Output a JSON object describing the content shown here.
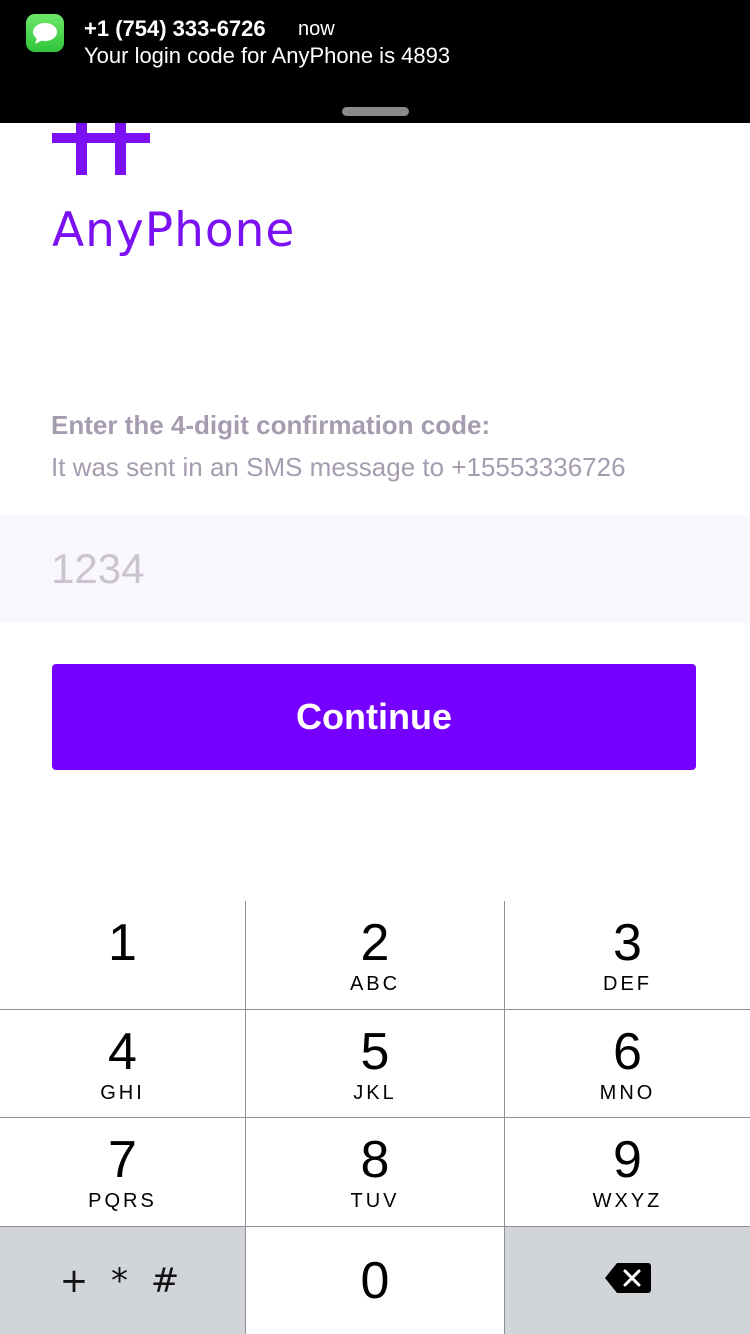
{
  "notification": {
    "app_icon": "messages-icon",
    "sender": "+1 (754) 333-6726",
    "time": "now",
    "message": "Your login code for AnyPhone is 4893"
  },
  "brand": {
    "name": "AnyPhone",
    "logo_icon": "hash-logo-icon",
    "color": "#7b10f2"
  },
  "prompt": {
    "heading": "Enter the 4-digit confirmation code:",
    "subtext": "It was sent in an SMS message to +15553336726"
  },
  "code_input": {
    "value": "",
    "placeholder": "1234"
  },
  "continue_button": {
    "label": "Continue",
    "color": "#7600ff"
  },
  "keypad": {
    "keys": [
      {
        "digit": "1",
        "letters": ""
      },
      {
        "digit": "2",
        "letters": "ABC"
      },
      {
        "digit": "3",
        "letters": "DEF"
      },
      {
        "digit": "4",
        "letters": "GHI"
      },
      {
        "digit": "5",
        "letters": "JKL"
      },
      {
        "digit": "6",
        "letters": "MNO"
      },
      {
        "digit": "7",
        "letters": "PQRS"
      },
      {
        "digit": "8",
        "letters": "TUV"
      },
      {
        "digit": "9",
        "letters": "WXYZ"
      },
      {
        "digit": "0",
        "letters": ""
      }
    ],
    "symbols_key": "+ * #",
    "delete_icon": "backspace-icon"
  }
}
